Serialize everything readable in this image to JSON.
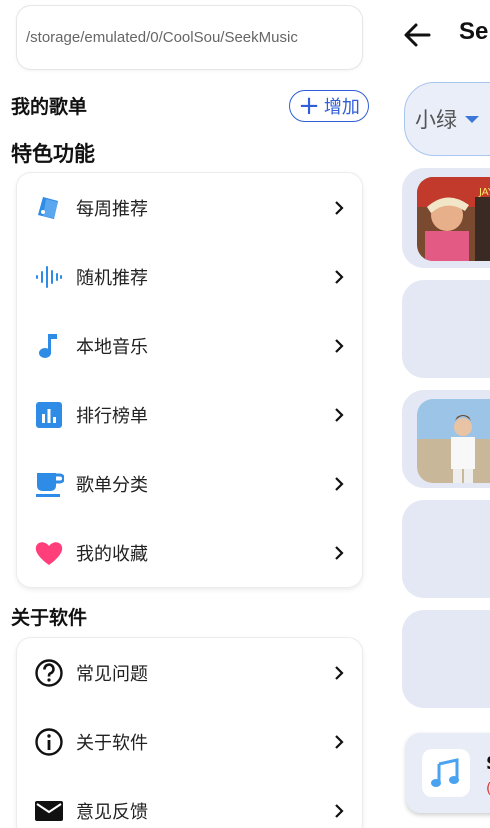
{
  "drawer": {
    "path_display": "/storage/emulated/0/CoolSou/SeekMusic",
    "my_playlists_title": "我的歌单",
    "add_button_label": "增加",
    "features_title": "特色功能",
    "features": [
      {
        "label": "每周推荐",
        "icon": "tag-icon"
      },
      {
        "label": "随机推荐",
        "icon": "sound-wave-icon"
      },
      {
        "label": "本地音乐",
        "icon": "music-note-icon"
      },
      {
        "label": "排行榜单",
        "icon": "bar-chart-icon"
      },
      {
        "label": "歌单分类",
        "icon": "cup-icon"
      },
      {
        "label": "我的收藏",
        "icon": "heart-icon"
      }
    ],
    "about_title": "关于软件",
    "about_items": [
      {
        "label": "常见问题",
        "icon": "question-icon"
      },
      {
        "label": "关于软件",
        "icon": "info-icon"
      },
      {
        "label": "意见反馈",
        "icon": "mail-icon"
      }
    ]
  },
  "page": {
    "title_fragment": "Se",
    "dropdown_value": "小绿",
    "player_title_fragment": "S",
    "player_subtitle_fragment": "("
  },
  "colors": {
    "accent_blue": "#2f5ed8",
    "icon_blue": "#2e8be6",
    "heart_pink": "#ff3e7a",
    "card_bg": "#e3e8f4"
  }
}
